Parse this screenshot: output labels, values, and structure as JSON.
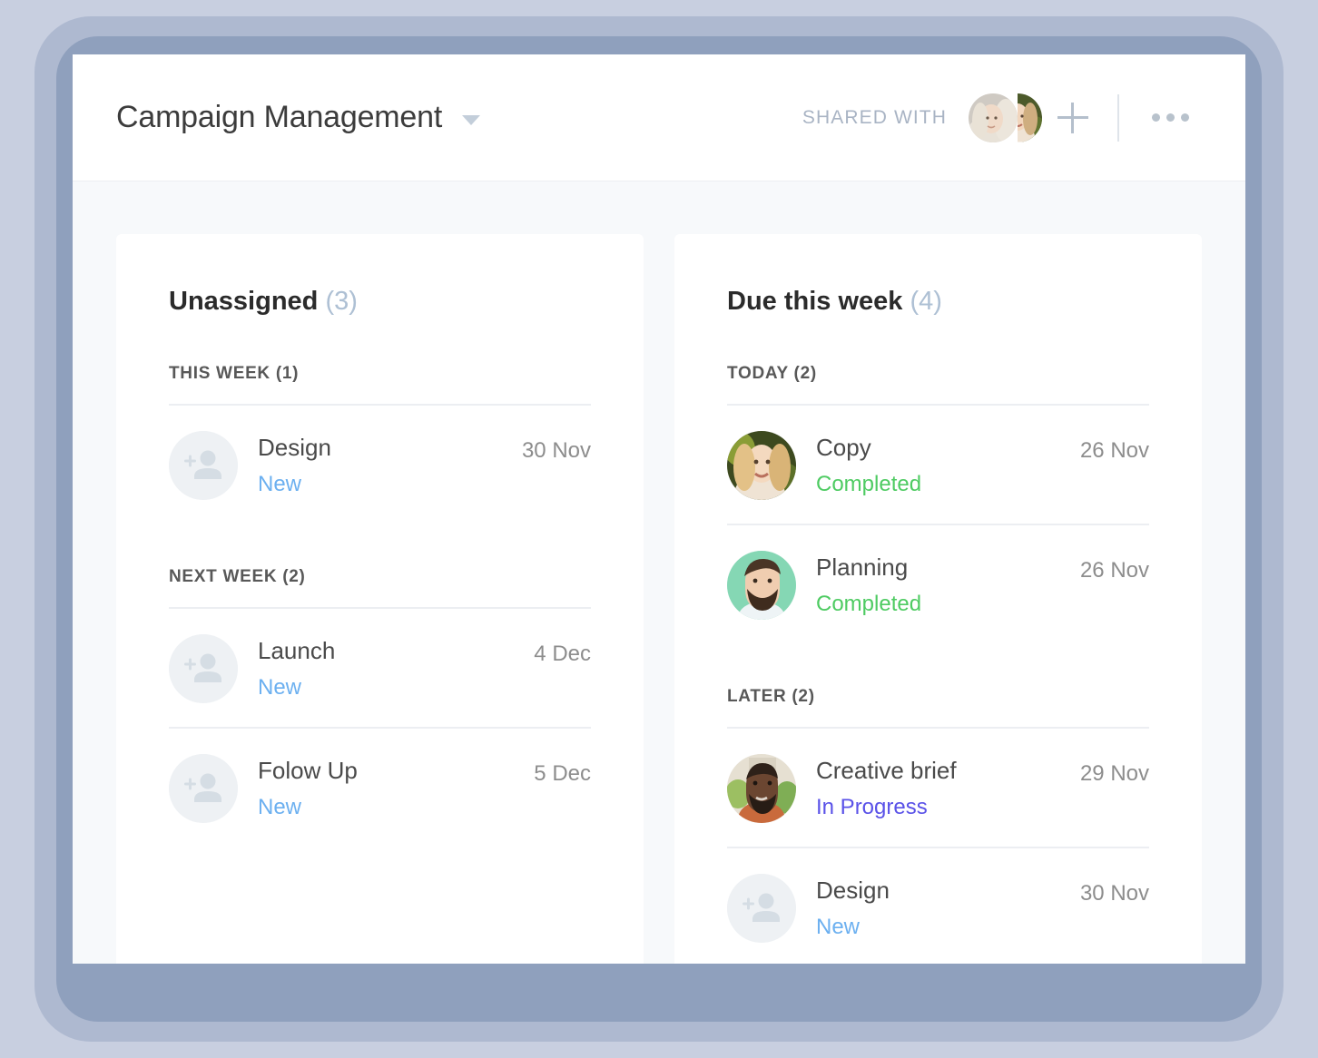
{
  "header": {
    "title": "Campaign Management",
    "caret_icon": "chevron-down-icon",
    "shared_with_label": "SHARED WITH",
    "add_person_label": "+",
    "more_label": "•••"
  },
  "columns": [
    {
      "title": "Unassigned",
      "count": "(3)",
      "sections": [
        {
          "label": "THIS WEEK (1)",
          "tasks": [
            {
              "name": "Design",
              "status": "New",
              "status_type": "new",
              "date": "30 Nov",
              "avatar": "placeholder"
            }
          ]
        },
        {
          "label": "NEXT WEEK (2)",
          "tasks": [
            {
              "name": "Launch",
              "status": "New",
              "status_type": "new",
              "date": "4 Dec",
              "avatar": "placeholder"
            },
            {
              "name": "Folow Up",
              "status": "New",
              "status_type": "new",
              "date": "5 Dec",
              "avatar": "placeholder"
            }
          ]
        }
      ]
    },
    {
      "title": "Due this week",
      "count": "(4)",
      "sections": [
        {
          "label": "TODAY (2)",
          "tasks": [
            {
              "name": "Copy",
              "status": "Completed",
              "status_type": "completed",
              "date": "26 Nov",
              "avatar": "photo-woman-blonde"
            },
            {
              "name": "Planning",
              "status": "Completed",
              "status_type": "completed",
              "date": "26 Nov",
              "avatar": "photo-man-beard"
            }
          ]
        },
        {
          "label": "LATER (2)",
          "tasks": [
            {
              "name": "Creative brief",
              "status": "In Progress",
              "status_type": "inprogress",
              "date": "29 Nov",
              "avatar": "photo-man-dark"
            },
            {
              "name": "Design",
              "status": "New",
              "status_type": "new",
              "date": "30 Nov",
              "avatar": "placeholder"
            }
          ]
        }
      ]
    }
  ],
  "colors": {
    "status_new": "#6cb0f0",
    "status_completed": "#4ecb62",
    "status_inprogress": "#5a52e8",
    "count_accent": "#aec0d4",
    "frame_outer": "#aeb9d0",
    "frame_inner": "#8fa0bd",
    "page_background": "#c8cfe0"
  }
}
